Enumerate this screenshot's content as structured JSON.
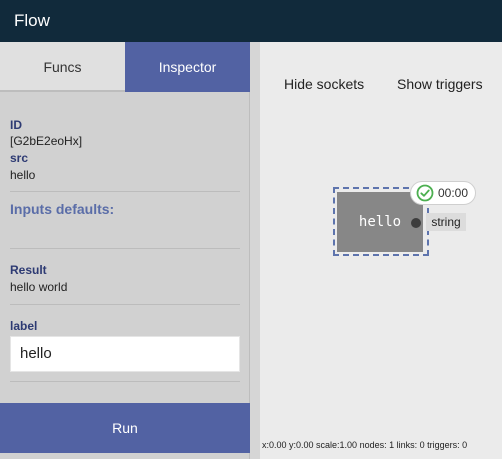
{
  "app": {
    "title": "Flow"
  },
  "sidebar": {
    "tabs": [
      "Funcs",
      "Inspector"
    ],
    "id_label": "ID",
    "id_value": "[G2bE2eoHx]",
    "src_label": "src",
    "src_value": "hello",
    "inputs_defaults_label": "Inputs defaults:",
    "result_label": "Result",
    "result_value": "hello world",
    "label_label": "label",
    "label_value": "hello",
    "run_label": "Run"
  },
  "canvas": {
    "hide_sockets_label": "Hide sockets",
    "show_triggers_label": "Show triggers",
    "node": {
      "title": "hello",
      "socket_type": "string",
      "timer": "00:00"
    },
    "status": "x:0.00 y:0.00 scale:1.00 nodes: 1 links: 0 triggers: 0"
  },
  "colors": {
    "topbar": "#112a3b",
    "accent": "#5262a3",
    "node": "#878787",
    "success": "#4caf50"
  }
}
